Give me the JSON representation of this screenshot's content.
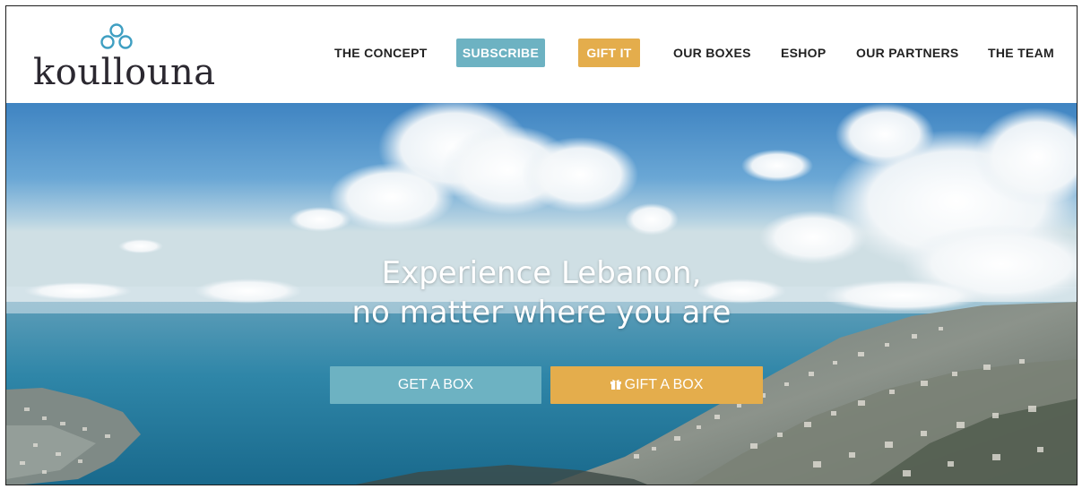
{
  "brand": {
    "name": "koullouna",
    "logo_icon": "trefoil-knot-icon",
    "logo_color": "#3f9fc2"
  },
  "nav": {
    "items": [
      {
        "label": "THE CONCEPT"
      },
      {
        "label": "SUBSCRIBE"
      },
      {
        "label": "GIFT IT"
      },
      {
        "label": "OUR BOXES"
      },
      {
        "label": "ESHOP"
      },
      {
        "label": "OUR PARTNERS"
      },
      {
        "label": "THE TEAM"
      }
    ]
  },
  "hero": {
    "title_line1": "Experience Lebanon,",
    "title_line2": "no matter where you are",
    "primary_cta": "GET A BOX",
    "secondary_cta": "GIFT A BOX",
    "secondary_icon": "gift-icon"
  },
  "colors": {
    "teal": "#6db2c2",
    "gold": "#e4ad4c",
    "text_dark": "#222222"
  }
}
